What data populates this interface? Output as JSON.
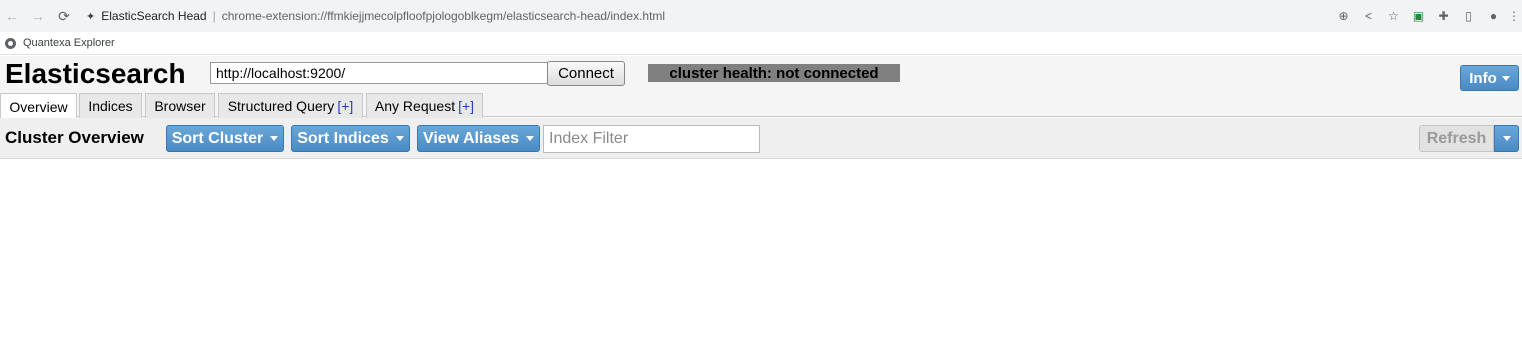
{
  "browser": {
    "site_name": "ElasticSearch Head",
    "url": "chrome-extension://ffmkiejjmecolpfloofpjologoblkegm/elasticsearch-head/index.html",
    "nav": {
      "back": "←",
      "forward": "→",
      "reload": "⟳"
    },
    "icons": [
      "zoom-icon",
      "share-icon",
      "star-icon",
      "extension-icon",
      "puzzle-icon",
      "sidepanel-icon",
      "profile-icon",
      "menu-icon"
    ],
    "icon_glyphs": {
      "zoom": "⊕",
      "share": "<",
      "star": "☆",
      "ext": "▣",
      "puzzle": "✚",
      "panel": "▯",
      "profile": "●",
      "menu": "⋮"
    }
  },
  "bookmarks": [
    {
      "label": "Quantexa Explorer"
    }
  ],
  "header": {
    "title": "Elasticsearch",
    "url_value": "http://localhost:9200/",
    "connect_label": "Connect",
    "cluster_health": "cluster health: not connected",
    "info_label": "Info"
  },
  "tabs": [
    {
      "label": "Overview",
      "plus": ""
    },
    {
      "label": "Indices",
      "plus": ""
    },
    {
      "label": "Browser",
      "plus": ""
    },
    {
      "label": "Structured Query",
      "plus": "[+]"
    },
    {
      "label": "Any Request",
      "plus": "[+]"
    }
  ],
  "overview": {
    "title": "Cluster Overview",
    "sort_cluster": "Sort Cluster",
    "sort_indices": "Sort Indices",
    "view_aliases": "View Aliases",
    "index_filter_placeholder": "Index Filter",
    "refresh_label": "Refresh"
  },
  "colors": {
    "accent": "#4a8bc5",
    "health_bg": "#808080",
    "tab_plus": "#2a3fc0"
  }
}
